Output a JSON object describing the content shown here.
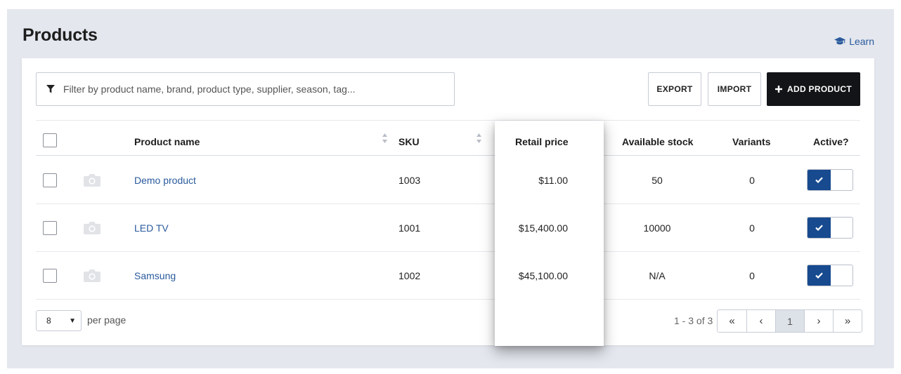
{
  "page": {
    "title": "Products",
    "learn_label": "Learn"
  },
  "toolbar": {
    "filter_placeholder": "Filter by product name, brand, product type, supplier, season, tag...",
    "export_label": "EXPORT",
    "import_label": "IMPORT",
    "add_label": "ADD PRODUCT"
  },
  "table": {
    "columns": {
      "name": "Product name",
      "sku": "SKU",
      "price": "Retail price",
      "stock": "Available stock",
      "variants": "Variants",
      "active": "Active?"
    },
    "rows": [
      {
        "name": "Demo product",
        "sku": "1003",
        "price": "$11.00",
        "stock": "50",
        "variants": "0",
        "active": true
      },
      {
        "name": "LED TV",
        "sku": "1001",
        "price": "$15,400.00",
        "stock": "10000",
        "variants": "0",
        "active": true
      },
      {
        "name": "Samsung",
        "sku": "1002",
        "price": "$45,100.00",
        "stock": "N/A",
        "variants": "0",
        "active": true
      }
    ]
  },
  "footer": {
    "per_page_value": "8",
    "per_page_label": "per page",
    "range_text": "1 - 3 of 3",
    "pager": {
      "first": "«",
      "prev": "‹",
      "current": "1",
      "next": "›",
      "last": "»"
    }
  },
  "icons": {
    "learn": "graduation-cap-icon",
    "filter": "filter-icon",
    "add": "plus-icon",
    "image_placeholder": "camera-icon",
    "toggle_on": "check-icon",
    "sort": "sort-icon"
  },
  "colors": {
    "background": "#e4e7ee",
    "link": "#2a5a9c",
    "primary_button": "#121417",
    "toggle_on": "#174a8f",
    "pager_active": "#dde1e8"
  }
}
